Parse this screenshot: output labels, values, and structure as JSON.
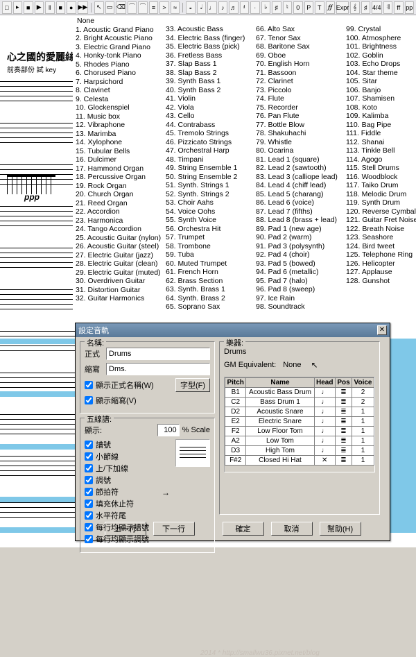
{
  "toolbar_icons": [
    "new",
    "open",
    "save",
    "play",
    "pause",
    "stop",
    "rec",
    "fwd",
    "|",
    "arrow",
    "select",
    "erase",
    "tie",
    "slur",
    "beam",
    "accent",
    "trem",
    "|",
    "note1",
    "note2",
    "note4",
    "note8",
    "note16",
    "rest",
    "dot",
    "flat",
    "sharp",
    "nat",
    "0",
    "P",
    "T",
    "rit",
    "Expr",
    "clef",
    "key",
    "time",
    "repeat",
    "ff",
    "pp"
  ],
  "score": {
    "title": "心之國的愛麗絲",
    "sub": "前奏部份 試 key",
    "dynamic": "ppp"
  },
  "instruments": {
    "none": "None",
    "col1": [
      "1. Acoustic Grand Piano",
      "2. Bright Acoustic Piano",
      "3. Electric Grand Piano",
      "4. Honky-tonk Piano",
      "5. Rhodes Piano",
      "6. Chorused Piano",
      "7. Harpsichord",
      "8. Clavinet",
      "9. Celesta",
      "10. Glockenspiel",
      "11. Music box",
      "12. Vibraphone",
      "13. Marimba",
      "14. Xylophone",
      "15. Tubular Bells",
      "16. Dulcimer",
      "17. Hammond Organ",
      "18. Percussive Organ",
      "19. Rock Organ",
      "20. Church Organ",
      "21. Reed Organ",
      "22. Accordion",
      "23. Harmonica",
      "24. Tango Accordion",
      "25. Acoustic Guitar (nylon)",
      "26. Acoustic Guitar (steel)",
      "27. Electric Guitar (jazz)",
      "28. Electric Guitar (clean)",
      "29. Electric Guitar (muted)",
      "30. Overdriven Guitar",
      "31. Distortion Guitar",
      "32. Guitar Harmonics"
    ],
    "col2": [
      "33. Acoustic Bass",
      "34. Electric Bass (finger)",
      "35. Electric Bass (pick)",
      "36. Fretless Bass",
      "37. Slap Bass 1",
      "38. Slap Bass 2",
      "39. Synth Bass 1",
      "40. Synth Bass 2",
      "41. Violin",
      "42. Viola",
      "43. Cello",
      "44. Contrabass",
      "45. Tremolo Strings",
      "46. Pizzicato Strings",
      "47. Orchestral Harp",
      "48. Timpani",
      "49. String Ensemble 1",
      "50. String Ensemble 2",
      "51. Synth. Strings 1",
      "52. Synth. Strings 2",
      "53. Choir Aahs",
      "54. Voice Oohs",
      "55. Synth Voice",
      "56. Orchestra Hit",
      "57. Trumpet",
      "58. Trombone",
      "59. Tuba",
      "60. Muted Trumpet",
      "61. French Horn",
      "62. Brass Section",
      "63. Synth. Brass 1",
      "64. Synth. Brass 2",
      "65. Soprano Sax"
    ],
    "col3": [
      "66. Alto Sax",
      "67. Tenor Sax",
      "68. Baritone Sax",
      "69. Oboe",
      "70. English Horn",
      "71. Bassoon",
      "72. Clarinet",
      "73. Piccolo",
      "74. Flute",
      "75. Recorder",
      "76. Pan Flute",
      "77. Bottle Blow",
      "78. Shakuhachi",
      "79. Whistle",
      "80. Ocarina",
      "81. Lead 1 (square)",
      "82. Lead 2 (sawtooth)",
      "83. Lead 3 (calliope lead)",
      "84. Lead 4 (chiff lead)",
      "85. Lead 5 (charang)",
      "86. Lead 6 (voice)",
      "87. Lead 7 (fifths)",
      "88. Lead 8 (brass + lead)",
      "89. Pad 1 (new age)",
      "90. Pad 2 (warm)",
      "91. Pad 3 (polysynth)",
      "92. Pad 4 (choir)",
      "93. Pad 5 (bowed)",
      "94. Pad 6 (metallic)",
      "95. Pad 7 (halo)",
      "96. Pad 8 (sweep)",
      "97. Ice Rain",
      "98. Soundtrack"
    ],
    "col4": [
      "99. Crystal",
      "100. Atmosphere",
      "101. Brightness",
      "102. Goblin",
      "103. Echo Drops",
      "104. Star theme",
      "105. Sitar",
      "106. Banjo",
      "107. Shamisen",
      "108. Koto",
      "109. Kalimba",
      "110. Bag Pipe",
      "111. Fiddle",
      "112. Shanai",
      "113. Tinkle Bell",
      "114. Agogo",
      "115. Stell Drums",
      "116. Woodblock",
      "117. Taiko Drum",
      "118. Melodic Drum",
      "119. Synth Drum",
      "120. Reverse Cymbal",
      "121. Guitar Fret Noise",
      "122. Breath Noise",
      "123. Seashore",
      "124. Bird tweet",
      "125. Telephone Ring",
      "126. Helicopter",
      "127. Applause",
      "128. Gunshot"
    ]
  },
  "dialog": {
    "title": "設定音軌",
    "watermark": "2014 * http://smallwu36.pixnet.net/blog",
    "name_group": "名稱:",
    "full_lbl": "正式",
    "full_val": "Drums",
    "abbr_lbl": "縮寫",
    "abbr_val": "Dms.",
    "chk_full": "顯示正式名稱(W)",
    "chk_abbr": "顯示縮寫(V)",
    "font_btn": "字型(F)",
    "staff_group": "五線譜:",
    "show_lbl": "顯示:",
    "scale_val": "100",
    "scale_lbl": "% Scale",
    "opts": [
      "譜號",
      "小節線",
      "上/下加線",
      "調號",
      "節拍符",
      "填充休止符",
      "水平符尾",
      "每行均顯示譜號",
      "每行均顯示調號"
    ],
    "instr_group": "樂器:",
    "instr_name": "Drums",
    "gm_lbl": "GM Equivalent:",
    "gm_val": "None",
    "tbl_head": [
      "Pitch",
      "Name",
      "Head",
      "Pos",
      "Voice"
    ],
    "tbl_rows": [
      [
        "B1",
        "Acoustic Bass Drum",
        "♩",
        "≣",
        "2"
      ],
      [
        "C2",
        "Bass Drum 1",
        "♩",
        "≣",
        "2"
      ],
      [
        "D2",
        "Acoustic Snare",
        "♩",
        "≣",
        "1"
      ],
      [
        "E2",
        "Electric Snare",
        "♩",
        "≣",
        "1"
      ],
      [
        "F2",
        "Low Floor Tom",
        "♩",
        "≣",
        "1"
      ],
      [
        "A2",
        "Low Tom",
        "♩",
        "≣",
        "1"
      ],
      [
        "D3",
        "High Tom",
        "♩",
        "≣",
        "1"
      ],
      [
        "F#2",
        "Closed Hi Hat",
        "✕",
        "≣",
        "1"
      ]
    ],
    "btn_prev": "上一行",
    "btn_next": "下一行",
    "btn_ok": "確定",
    "btn_cancel": "取消",
    "btn_help": "幫助(H)"
  }
}
